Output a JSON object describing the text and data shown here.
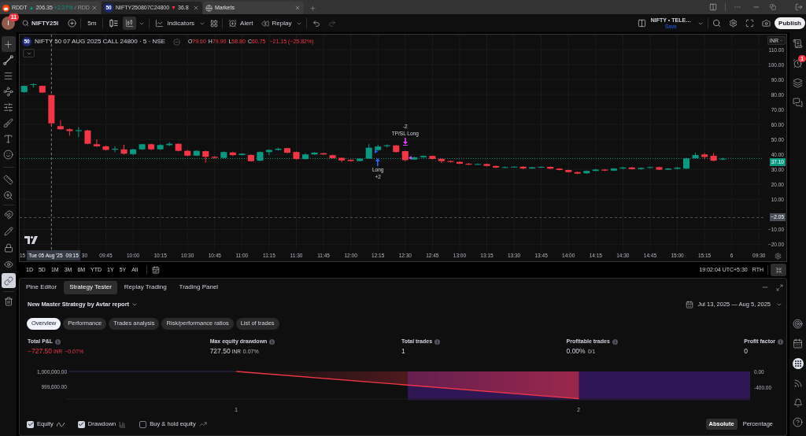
{
  "browser_tabs": [
    {
      "kind": "ticker",
      "symbol": "RDDT",
      "arrow": "▲",
      "price": "206.35",
      "change": "+2.27%",
      "suffix": "/ RDD",
      "negative": false,
      "selected": false
    },
    {
      "kind": "ticker",
      "badge": "50",
      "symbol": "NIFTY250807C24800",
      "arrow": "▼",
      "price": "36.8",
      "negative": true,
      "selected": true
    },
    {
      "kind": "page",
      "title": "Markets",
      "selected": false
    }
  ],
  "toolbar": {
    "avatar_initial": "I",
    "notification_count": "11",
    "symbol": "NIFTY25I",
    "interval": "5m",
    "chart_styles": [
      {
        "selected": false
      },
      {
        "selected": true
      }
    ],
    "indicators": "Indicators",
    "alert": "Alert",
    "replay": "Replay",
    "layout_name": "NIFTY • TELE…",
    "layout_status": "Save",
    "publish": "Publish"
  },
  "left_toolbar": {
    "tools": [
      {
        "selected": true
      },
      {
        "selected": false
      },
      {
        "selected": false
      },
      {
        "selected": false
      },
      {
        "selected": false
      },
      {
        "selected": false
      },
      {
        "selected": false
      },
      {
        "selected": false
      },
      {
        "selected": false
      },
      {
        "selected": false
      }
    ],
    "toggles": [
      {
        "on": false
      },
      {
        "on": false
      },
      {
        "on": false
      },
      {
        "on": false
      },
      {
        "on": true
      }
    ]
  },
  "chart": {
    "legend": {
      "badge": "50",
      "title": "NIFTY 50 07 AUG 2025 CALL 24800 · 5 · NSE",
      "ohlc": [
        {
          "label": "O",
          "value": "79.60"
        },
        {
          "label": "H",
          "value": "79.90"
        },
        {
          "label": "L",
          "value": "58.80"
        },
        {
          "label": "C",
          "value": "60.75"
        }
      ],
      "change": "−21.15 (−25.82%)",
      "negative": true
    },
    "currency": "INR",
    "markers": [
      {
        "kind": "exit",
        "lines": [
          "-2",
          "TP/SL Long"
        ]
      },
      {
        "kind": "entry",
        "lines": [
          "Long",
          "+2"
        ]
      }
    ],
    "time_axis_fragments": [
      "15",
      "30"
    ],
    "crosshair_date": "Tue 05 Aug '25",
    "crosshair_time": "09:15",
    "chart_data": {
      "type": "candlestick",
      "grid": true,
      "categories": [
        null,
        null,
        null,
        null,
        null,
        null,
        null,
        null,
        null,
        "09:45",
        null,
        null,
        "10:00",
        null,
        null,
        "10:15",
        null,
        null,
        "10:30",
        null,
        null,
        "10:45",
        null,
        null,
        "11:00",
        null,
        null,
        "11:15",
        null,
        null,
        "11:30",
        null,
        null,
        "11:45",
        null,
        null,
        "12:00",
        null,
        null,
        "12:15",
        null,
        null,
        "12:30",
        null,
        null,
        "12:45",
        null,
        null,
        "13:00",
        null,
        null,
        "13:15",
        null,
        null,
        "13:30",
        null,
        null,
        "13:45",
        null,
        null,
        "14:00",
        null,
        null,
        "14:15",
        null,
        null,
        "14:30",
        null,
        null,
        "14:45",
        null,
        null,
        "15:00",
        null,
        null,
        "15:15",
        null,
        null,
        "6",
        null,
        null,
        "09:30"
      ],
      "ohlc": [
        [
          81.6,
          86,
          81.3,
          85.8
        ],
        [
          86.4,
          87.5,
          84.7,
          86.9
        ],
        [
          85.8,
          86,
          81,
          81.3
        ],
        [
          79.6,
          79.9,
          58.8,
          60.75
        ],
        [
          58.9,
          62.9,
          56.5,
          56.8
        ],
        [
          56.8,
          57.5,
          52.5,
          55.6
        ],
        [
          55.6,
          58.2,
          51.6,
          56.2
        ],
        [
          56,
          56.5,
          46.8,
          47.1
        ],
        [
          46.8,
          50,
          45,
          45.4
        ],
        [
          45.4,
          46,
          42.6,
          43
        ],
        [
          43.2,
          45.4,
          41.4,
          43.8
        ],
        [
          43.4,
          46.5,
          40,
          40.5
        ],
        [
          40.2,
          43.8,
          39.5,
          43.4
        ],
        [
          43.4,
          47,
          43,
          46.8
        ],
        [
          46.8,
          47.2,
          42.8,
          43.4
        ],
        [
          43.4,
          46.8,
          43,
          46.3
        ],
        [
          46.2,
          48.2,
          45.5,
          47.1
        ],
        [
          47.1,
          47.5,
          42,
          42.4
        ],
        [
          42.4,
          43,
          38.8,
          39.2
        ],
        [
          39.2,
          42.8,
          38.9,
          42.4
        ],
        [
          42.2,
          42.6,
          34.5,
          38.4
        ],
        [
          38.4,
          38.8,
          37.3,
          37.7
        ],
        [
          37.7,
          42,
          37.4,
          41.6
        ],
        [
          41.3,
          41.8,
          39,
          39.5
        ],
        [
          39.6,
          40.8,
          39.3,
          40.5
        ],
        [
          39.6,
          40,
          35.2,
          35.5
        ],
        [
          35.8,
          42,
          35.5,
          41.6
        ],
        [
          41.6,
          43.3,
          39.5,
          43
        ],
        [
          43,
          44.6,
          42.6,
          43.8
        ],
        [
          44.2,
          44.5,
          40.8,
          41.1
        ],
        [
          41.6,
          42,
          36.6,
          36.9
        ],
        [
          36.9,
          40.8,
          36.6,
          40
        ],
        [
          40,
          41.5,
          39.7,
          41.2
        ],
        [
          40.8,
          41,
          39.7,
          40
        ],
        [
          39.5,
          39.8,
          37.2,
          37.5
        ],
        [
          37.7,
          38,
          34.8,
          36
        ],
        [
          36.4,
          36.7,
          35.3,
          35.6
        ],
        [
          35.6,
          37.5,
          35.4,
          37.2
        ],
        [
          37.2,
          47,
          37,
          44.5
        ],
        [
          42.9,
          46.5,
          42.5,
          45.3
        ],
        [
          45.5,
          46.8,
          44.6,
          46.1
        ],
        [
          46,
          46.3,
          41.3,
          41.6
        ],
        [
          42.2,
          42.5,
          35.5,
          36.2
        ],
        [
          36.6,
          38.4,
          36.3,
          38.1
        ],
        [
          38.1,
          39.3,
          37.8,
          39
        ],
        [
          39,
          39.3,
          36.7,
          37
        ],
        [
          37,
          37.3,
          34.2,
          35.5
        ],
        [
          35.6,
          36,
          34.5,
          35
        ],
        [
          35,
          35.4,
          33.5,
          33.8
        ],
        [
          33.8,
          34.2,
          32.8,
          33.2
        ],
        [
          33.2,
          34,
          32.9,
          33.6
        ],
        [
          33.6,
          33.9,
          32,
          32.3
        ],
        [
          32.3,
          32.6,
          30.9,
          31.2
        ],
        [
          31.2,
          31.9,
          30.8,
          31.5
        ],
        [
          31.5,
          32.1,
          31.2,
          31.8
        ],
        [
          31.8,
          32.1,
          30.2,
          30.6
        ],
        [
          30.6,
          31.7,
          30.3,
          31.4
        ],
        [
          31.4,
          32,
          31.1,
          31.7
        ],
        [
          31.7,
          32,
          30.2,
          30.5
        ],
        [
          30.5,
          30.8,
          29.3,
          29.6
        ],
        [
          29.6,
          29.9,
          27.9,
          28.2
        ],
        [
          28.2,
          28.6,
          26.8,
          27.2
        ],
        [
          27.4,
          29.3,
          27.1,
          29
        ],
        [
          29,
          30.3,
          28.7,
          29.9
        ],
        [
          29.9,
          30.2,
          28.8,
          29.2
        ],
        [
          29.2,
          30.9,
          28.9,
          30.6
        ],
        [
          30.6,
          31.6,
          30.3,
          31.3
        ],
        [
          31.3,
          31.6,
          29.9,
          30.2
        ],
        [
          30.2,
          31.3,
          29.9,
          31
        ],
        [
          31,
          31.9,
          30.7,
          31.5
        ],
        [
          31.5,
          31.8,
          29.5,
          29.8
        ],
        [
          29.8,
          30.9,
          29.5,
          30.6
        ],
        [
          30.4,
          31.5,
          30,
          31.2
        ],
        [
          30.5,
          37.8,
          30.2,
          37.4
        ],
        [
          37.5,
          41.2,
          37.2,
          39.6
        ],
        [
          40,
          41,
          36.8,
          38.3
        ],
        [
          39.1,
          41,
          35.5,
          35.8
        ],
        [
          36.6,
          37.8,
          36.3,
          37.1
        ],
        null,
        null,
        null,
        null
      ],
      "ylim": [
        -24,
        120
      ],
      "yticks": [
        {
          "value": 110,
          "label": "110.00"
        },
        {
          "value": 100,
          "label": "100.00"
        },
        {
          "value": 90,
          "label": "90.00"
        },
        {
          "value": 80,
          "label": "80.00"
        },
        {
          "value": 70,
          "label": "70.00"
        },
        {
          "value": 60,
          "label": "60.00"
        },
        {
          "value": 50,
          "label": "50.00"
        },
        {
          "value": 40,
          "label": "40.00"
        },
        {
          "value": 30,
          "label": "30.00"
        },
        {
          "value": 20,
          "label": "20.00"
        },
        {
          "value": 10,
          "label": "10.00"
        },
        {
          "value": -10,
          "label": "−10.00"
        },
        {
          "value": -20,
          "label": "−20.00"
        }
      ],
      "ref_lines": [
        {
          "axis": "y",
          "value": 37.1,
          "label": "37.10",
          "color": "#089981"
        },
        {
          "axis": "y",
          "value": -2.05,
          "label": "−2.05",
          "color": "#4a4e5a"
        }
      ]
    }
  },
  "right_sidebar": {
    "alert_count": "1"
  },
  "range_bar": {
    "ranges": [
      "1D",
      "5D",
      "1M",
      "3M",
      "6M",
      "YTD",
      "1Y",
      "5Y",
      "All"
    ],
    "clock": "19:02:04 UTC+5:30",
    "session": "RTH"
  },
  "bottom_panel": {
    "tabs": [
      {
        "label": "Pine Editor",
        "selected": false
      },
      {
        "label": "Strategy Tester",
        "selected": true
      },
      {
        "label": "Replay Trading",
        "selected": false
      },
      {
        "label": "Trading Panel",
        "selected": false
      }
    ],
    "strategy": {
      "title": "New Master Strategy by Avtar report",
      "date_range": "Jul 13, 2025 — Aug 5, 2025",
      "report_tabs": [
        {
          "label": "Overview",
          "selected": true
        },
        {
          "label": "Performance",
          "selected": false
        },
        {
          "label": "Trades analysis",
          "selected": false
        },
        {
          "label": "Risk/performance ratios",
          "selected": false
        },
        {
          "label": "List of trades",
          "selected": false
        }
      ],
      "metrics": [
        {
          "label": "Total P&L",
          "value": "−727.50",
          "unit": "INR",
          "extra": "−0.07%",
          "negative": true
        },
        {
          "label": "Max equity drawdown",
          "value": "727.50",
          "unit": "INR",
          "extra": "0.07%",
          "negative": false
        },
        {
          "label": "Total trades",
          "value": "1",
          "negative": false
        },
        {
          "label": "Profitable trades",
          "value": "0.00%",
          "extra": "0/1",
          "negative": false
        },
        {
          "label": "Profit factor",
          "value": "0",
          "negative": false
        }
      ],
      "equity_chart": {
        "chart_data": {
          "type": "line",
          "categories": [
            "1",
            "2"
          ],
          "ylim": [
            999272.5,
            1000000
          ],
          "yticks": [
            {
              "value": 1000000,
              "label": "1,000,000.00"
            },
            {
              "value": 999600,
              "label": "999,600.00"
            }
          ],
          "series": [
            {
              "color": "#f23645",
              "values": [
                1000000,
                999272.5
              ]
            }
          ]
        }
      },
      "drawdown_chart": {
        "chart_data": {
          "type": "bar",
          "categories": [
            null,
            null
          ],
          "ylim": [
            -727.5,
            0
          ],
          "yticks": [
            {
              "value": 0,
              "label": "0.00"
            },
            {
              "value": -400,
              "label": "-400.00"
            }
          ],
          "series": [
            {
              "color": "#2f1654",
              "values": [
                null,
                -727.5
              ]
            }
          ]
        }
      },
      "series_toggles": [
        {
          "label": "Equity",
          "checked": true
        },
        {
          "label": "Drawdown",
          "checked": true
        },
        {
          "label": "Buy & hold equity",
          "checked": false
        }
      ],
      "scale_modes": [
        {
          "label": "Absolute",
          "selected": true
        },
        {
          "label": "Percentage",
          "selected": false
        }
      ]
    }
  }
}
